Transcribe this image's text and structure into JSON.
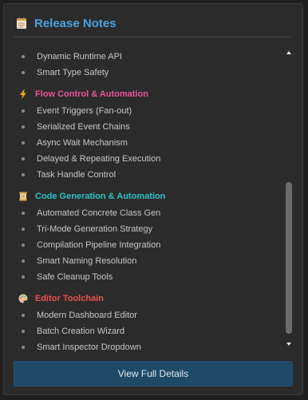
{
  "panel": {
    "title": "Release Notes",
    "title_icon": "notepad-icon"
  },
  "top_items": [
    "Dynamic Runtime API",
    "Smart Type Safety"
  ],
  "sections": [
    {
      "title": "Flow Control & Automation",
      "icon": "lightning-icon",
      "color": "#e8559a",
      "items": [
        "Event Triggers (Fan-out)",
        "Serialized Event Chains",
        "Async Wait Mechanism",
        "Delayed & Repeating Execution",
        "Task Handle Control"
      ]
    },
    {
      "title": "Code Generation & Automation",
      "icon": "scroll-icon",
      "color": "#2fc2c9",
      "items": [
        "Automated Concrete Class Gen",
        "Tri-Mode Generation Strategy",
        "Compilation Pipeline Integration",
        "Smart Naming Resolution",
        "Safe Cleanup Tools"
      ]
    },
    {
      "title": "Editor Toolchain",
      "icon": "palette-icon",
      "color": "#e8524c",
      "items": [
        "Modern Dashboard Editor",
        "Batch Creation Wizard",
        "Smart Inspector Dropdown"
      ]
    }
  ],
  "scrollbar": {
    "position_fraction": 0.48,
    "visible_fraction": 0.55
  },
  "button": {
    "label": "View Full Details"
  }
}
